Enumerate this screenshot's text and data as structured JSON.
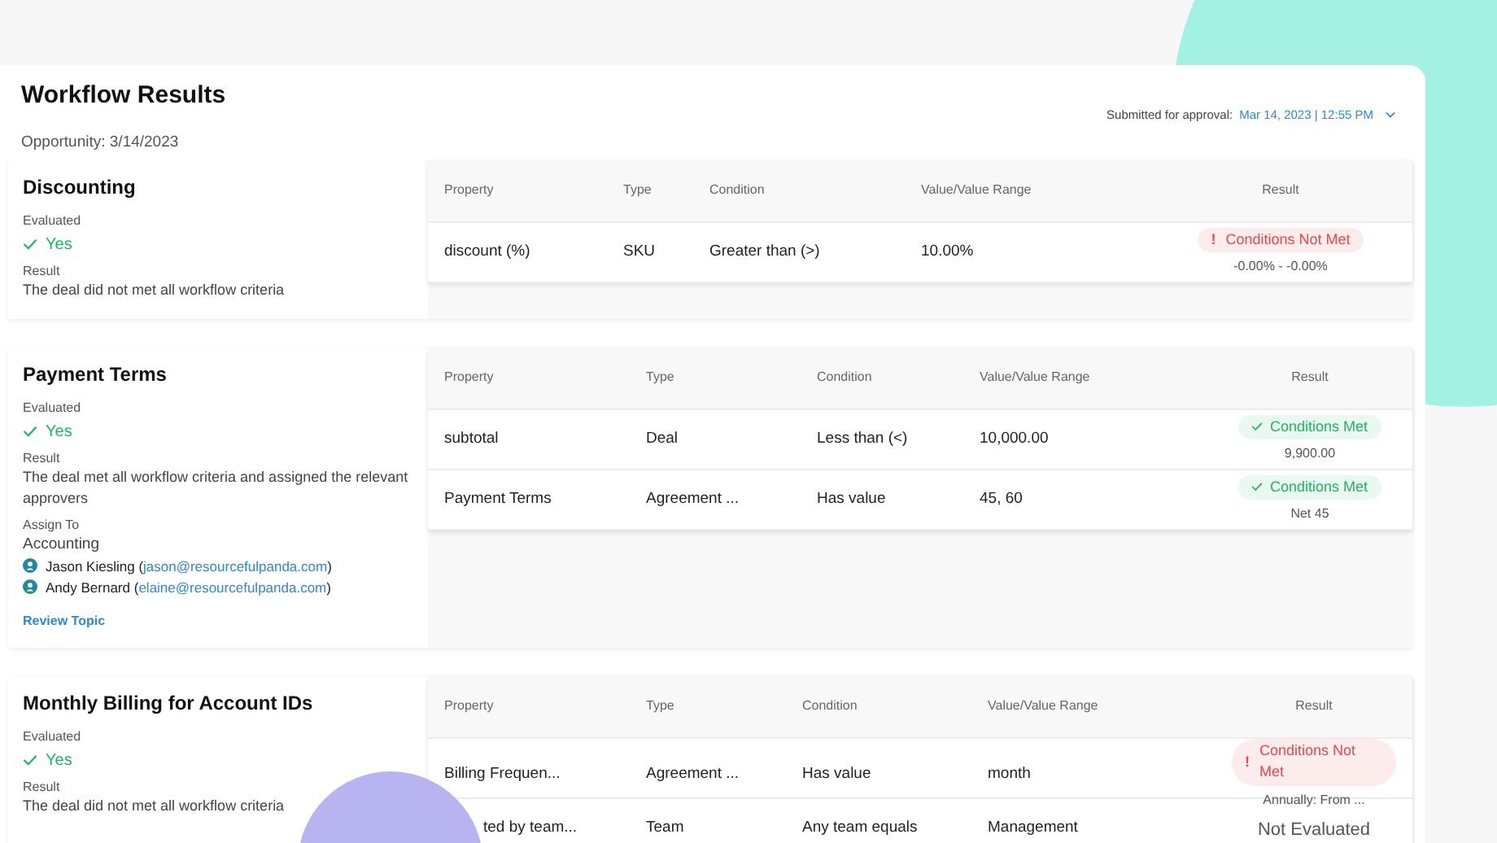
{
  "title": "Workflow Results",
  "opportunity": {
    "label": "Opportunity:",
    "value": "3/14/2023"
  },
  "submitted": {
    "label": "Submitted for approval:",
    "value": "Mar 14, 2023 | 12:55 PM"
  },
  "sections": [
    {
      "name": "Discounting",
      "evaluated_label": "Evaluated",
      "evaluated": "Yes",
      "result_label": "Result",
      "result": "The deal did not met all workflow criteria",
      "columns": [
        "Property",
        "Type",
        "Condition",
        "Value/Value Range",
        "Result"
      ],
      "rows": [
        {
          "property": "discount (%)",
          "type": "SKU",
          "condition": "Greater than (>)",
          "value": "10.00%",
          "result": {
            "kind": "not_met",
            "mark": "!",
            "label": "Conditions Not Met",
            "detail": "-0.00% - -0.00%"
          }
        }
      ]
    },
    {
      "name": "Payment Terms",
      "evaluated_label": "Evaluated",
      "evaluated": "Yes",
      "result_label": "Result",
      "result": "The deal met all workflow criteria and assigned the relevant approvers",
      "assign_label": "Assign To",
      "assign_group": "Accounting",
      "assignees": [
        {
          "name": "Jason Kiesling",
          "open": "(",
          "email": "jason@resourcefulpanda.com",
          "close": ")"
        },
        {
          "name": "Andy Bernard",
          "open": "(",
          "email": "elaine@resourcefulpanda.com",
          "close": ")"
        }
      ],
      "link": "Review Topic",
      "columns": [
        "Property",
        "Type",
        "Condition",
        "Value/Value Range",
        "Result"
      ],
      "rows": [
        {
          "property": "subtotal",
          "type": "Deal",
          "condition": "Less than (<)",
          "value": "10,000.00",
          "result": {
            "kind": "met",
            "label": "Conditions Met",
            "detail": "9,900.00"
          }
        },
        {
          "property": "Payment Terms",
          "type": "Agreement ...",
          "condition": "Has value",
          "value": "45, 60",
          "result": {
            "kind": "met",
            "label": "Conditions Met",
            "detail": "Net 45"
          }
        }
      ]
    },
    {
      "name": "Monthly Billing for Account IDs",
      "evaluated_label": "Evaluated",
      "evaluated": "Yes",
      "result_label": "Result",
      "result": "The deal did not met all workflow criteria",
      "columns": [
        "Property",
        "Type",
        "Condition",
        "Value/Value Range",
        "Result"
      ],
      "rows": [
        {
          "property": "Billing Frequen...",
          "type": "Agreement ...",
          "condition": "Has value",
          "value": "month",
          "result": {
            "kind": "not_met",
            "mark": "!",
            "label": "Conditions Not Met",
            "detail": "Annually: From ..."
          }
        },
        {
          "property": "ted by team...",
          "type": "Team",
          "condition": "Any team equals",
          "value": "Management",
          "result": {
            "kind": "not_evaluated",
            "label": "Not Evaluated"
          }
        }
      ]
    }
  ]
}
